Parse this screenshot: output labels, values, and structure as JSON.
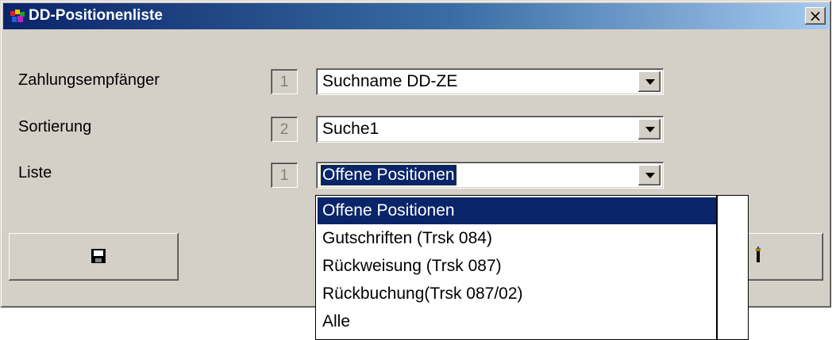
{
  "window": {
    "title": "DD-Positionenliste",
    "close_symbol": "×"
  },
  "fields": [
    {
      "label": "Zahlungsempfänger",
      "number": "1",
      "value": "Suchname DD-ZE"
    },
    {
      "label": "Sortierung",
      "number": "2",
      "value": "Suche1"
    },
    {
      "label": "Liste",
      "number": "1",
      "value": "Offene Positionen"
    }
  ],
  "dropdown": {
    "options": [
      "Offene Positionen",
      "Gutschriften (Trsk 084)",
      "Rückweisung (Trsk 087)",
      "Rückbuchung(Trsk 087/02)",
      "Alle"
    ],
    "selected_index": 0
  },
  "buttons": {
    "save_icon": "floppy-disk-icon",
    "right_icon": "tool-icon"
  },
  "colors": {
    "titlebar_start": "#0a246a",
    "titlebar_end": "#a6caf0",
    "selection": "#0a246a",
    "face": "#d4d0c8"
  }
}
